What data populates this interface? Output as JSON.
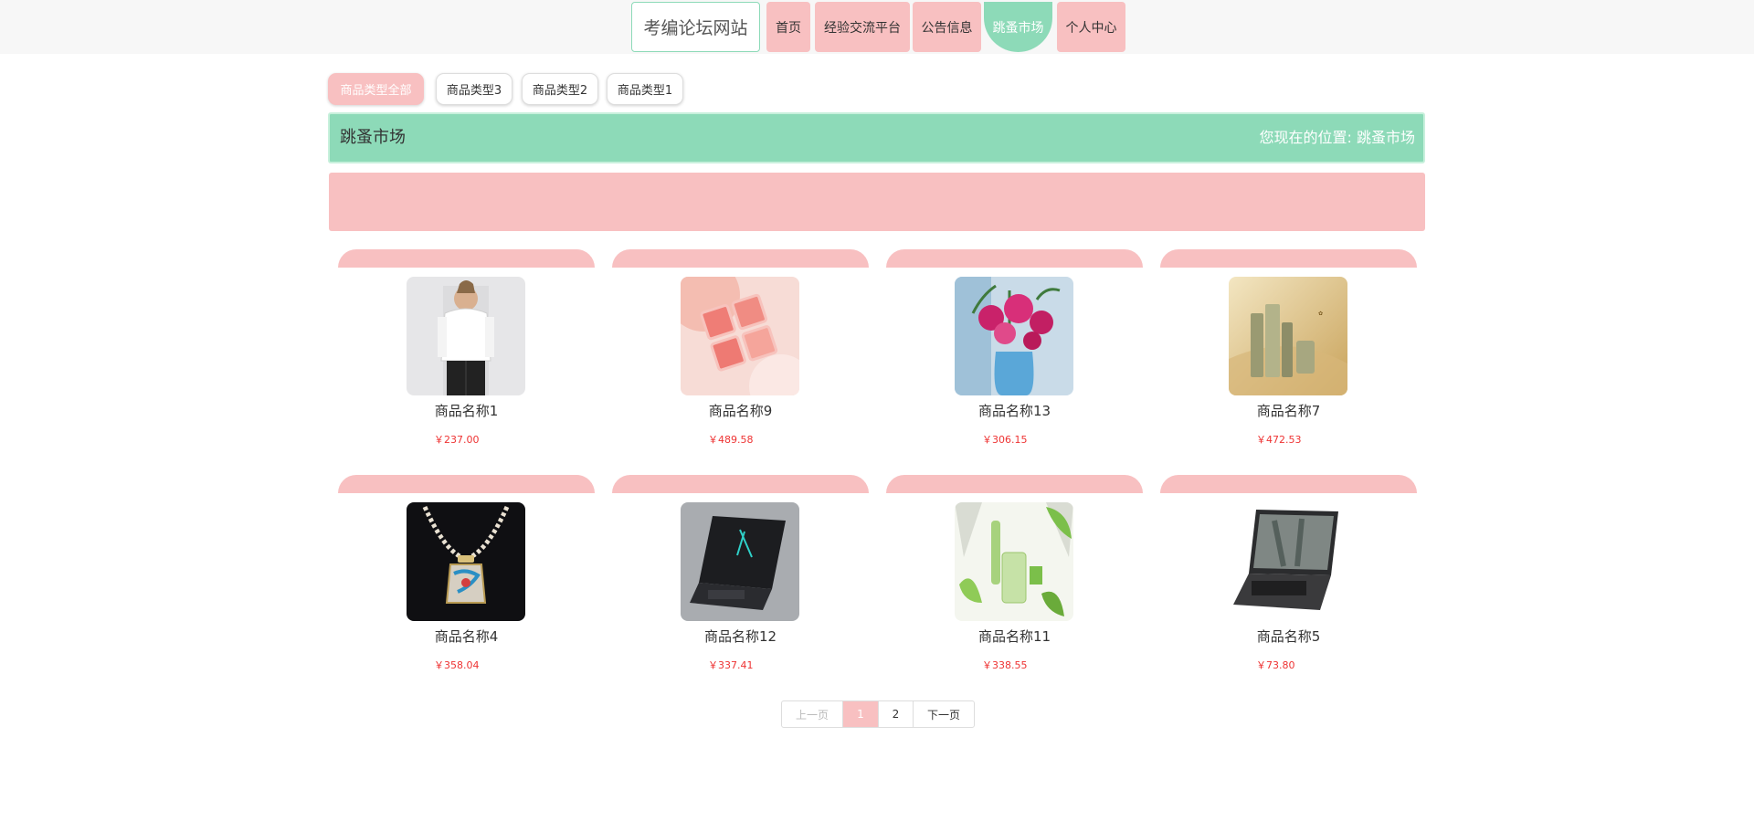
{
  "header": {
    "site_title": "考编论坛网站",
    "nav": [
      {
        "label": "首页"
      },
      {
        "label": "经验交流平台"
      },
      {
        "label": "公告信息"
      },
      {
        "label": "跳蚤市场",
        "active": true
      },
      {
        "label": "个人中心"
      }
    ]
  },
  "categories": [
    {
      "label": "商品类型全部",
      "active": true
    },
    {
      "label": "商品类型3"
    },
    {
      "label": "商品类型2"
    },
    {
      "label": "商品类型1"
    }
  ],
  "location": {
    "title": "跳蚤市场",
    "prefix": "您现在的位置:",
    "current": "跳蚤市场"
  },
  "products": [
    {
      "name": "商品名称1",
      "price": "￥237.00",
      "image": "shirt-photo"
    },
    {
      "name": "商品名称9",
      "price": "￥489.58",
      "image": "blush-palette-photo"
    },
    {
      "name": "商品名称13",
      "price": "￥306.15",
      "image": "flower-vase-photo"
    },
    {
      "name": "商品名称7",
      "price": "￥472.53",
      "image": "cosmetics-set-photo"
    },
    {
      "name": "商品名称4",
      "price": "￥358.04",
      "image": "pendant-necklace-photo"
    },
    {
      "name": "商品名称12",
      "price": "￥337.41",
      "image": "gaming-laptop-photo"
    },
    {
      "name": "商品名称11",
      "price": "￥338.55",
      "image": "green-skincare-photo"
    },
    {
      "name": "商品名称5",
      "price": "￥73.80",
      "image": "laptop-photo"
    }
  ],
  "pagination": {
    "prev": "上一页",
    "pages": [
      "1",
      "2"
    ],
    "current": "1",
    "next": "下一页"
  },
  "colors": {
    "accent_green": "#8ddab8",
    "accent_pink": "#f8c0c1",
    "price_red": "#ee3333"
  }
}
